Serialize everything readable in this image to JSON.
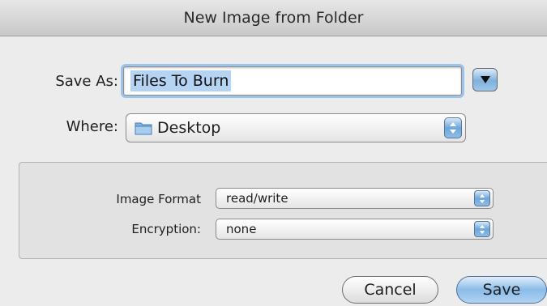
{
  "window": {
    "title": "New Image from Folder"
  },
  "save_as": {
    "label": "Save As:",
    "value": "Files To Burn"
  },
  "where": {
    "label": "Where:",
    "value": "Desktop"
  },
  "options": {
    "image_format": {
      "label": "Image Format",
      "value": "read/write"
    },
    "encryption": {
      "label": "Encryption:",
      "value": "none"
    }
  },
  "buttons": {
    "cancel": "Cancel",
    "save": "Save"
  },
  "icons": {
    "expand": "disclosure-triangle-icon",
    "folder": "folder-icon",
    "stepper": "up-down-arrows-icon"
  },
  "colors": {
    "focus_ring": "#9cc3ea",
    "selection": "#b5d4f4",
    "aqua_button": "#7fb0dd"
  }
}
